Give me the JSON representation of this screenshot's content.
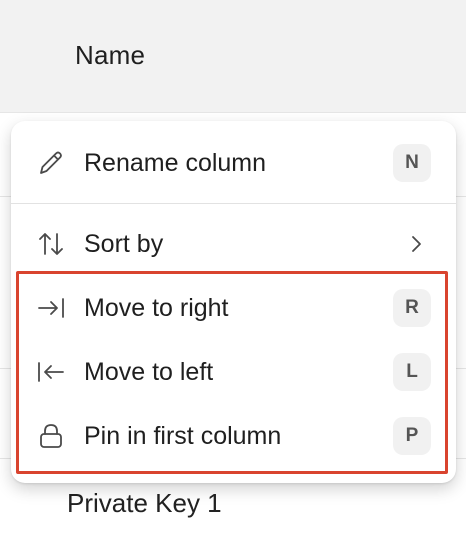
{
  "table": {
    "header_label": "Name",
    "visible_row_label": "Private Key 1"
  },
  "menu": {
    "items": [
      {
        "label": "Rename column",
        "shortcut": "N",
        "icon": "pencil-icon"
      },
      {
        "label": "Sort by",
        "icon": "sort-arrows-icon",
        "submenu_icon": "chevron-right-icon"
      },
      {
        "label": "Move to right",
        "shortcut": "R",
        "icon": "arrow-right-to-bar-icon"
      },
      {
        "label": "Move to left",
        "shortcut": "L",
        "icon": "arrow-left-to-bar-icon"
      },
      {
        "label": "Pin in first column",
        "shortcut": "P",
        "icon": "lock-icon"
      }
    ]
  },
  "colors": {
    "header_background": "#f2f2f2",
    "highlight_border": "#d9442f",
    "shortcut_background": "#f1f1f1"
  }
}
